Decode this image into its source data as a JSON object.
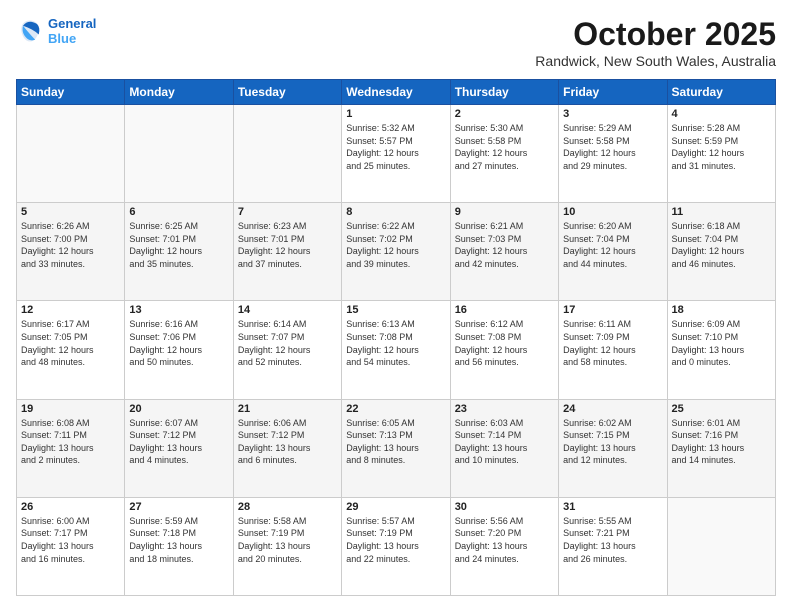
{
  "header": {
    "logo_line1": "General",
    "logo_line2": "Blue",
    "title": "October 2025",
    "location": "Randwick, New South Wales, Australia"
  },
  "days_of_week": [
    "Sunday",
    "Monday",
    "Tuesday",
    "Wednesday",
    "Thursday",
    "Friday",
    "Saturday"
  ],
  "weeks": [
    [
      {
        "day": "",
        "info": ""
      },
      {
        "day": "",
        "info": ""
      },
      {
        "day": "",
        "info": ""
      },
      {
        "day": "1",
        "info": "Sunrise: 5:32 AM\nSunset: 5:57 PM\nDaylight: 12 hours\nand 25 minutes."
      },
      {
        "day": "2",
        "info": "Sunrise: 5:30 AM\nSunset: 5:58 PM\nDaylight: 12 hours\nand 27 minutes."
      },
      {
        "day": "3",
        "info": "Sunrise: 5:29 AM\nSunset: 5:58 PM\nDaylight: 12 hours\nand 29 minutes."
      },
      {
        "day": "4",
        "info": "Sunrise: 5:28 AM\nSunset: 5:59 PM\nDaylight: 12 hours\nand 31 minutes."
      }
    ],
    [
      {
        "day": "5",
        "info": "Sunrise: 6:26 AM\nSunset: 7:00 PM\nDaylight: 12 hours\nand 33 minutes."
      },
      {
        "day": "6",
        "info": "Sunrise: 6:25 AM\nSunset: 7:01 PM\nDaylight: 12 hours\nand 35 minutes."
      },
      {
        "day": "7",
        "info": "Sunrise: 6:23 AM\nSunset: 7:01 PM\nDaylight: 12 hours\nand 37 minutes."
      },
      {
        "day": "8",
        "info": "Sunrise: 6:22 AM\nSunset: 7:02 PM\nDaylight: 12 hours\nand 39 minutes."
      },
      {
        "day": "9",
        "info": "Sunrise: 6:21 AM\nSunset: 7:03 PM\nDaylight: 12 hours\nand 42 minutes."
      },
      {
        "day": "10",
        "info": "Sunrise: 6:20 AM\nSunset: 7:04 PM\nDaylight: 12 hours\nand 44 minutes."
      },
      {
        "day": "11",
        "info": "Sunrise: 6:18 AM\nSunset: 7:04 PM\nDaylight: 12 hours\nand 46 minutes."
      }
    ],
    [
      {
        "day": "12",
        "info": "Sunrise: 6:17 AM\nSunset: 7:05 PM\nDaylight: 12 hours\nand 48 minutes."
      },
      {
        "day": "13",
        "info": "Sunrise: 6:16 AM\nSunset: 7:06 PM\nDaylight: 12 hours\nand 50 minutes."
      },
      {
        "day": "14",
        "info": "Sunrise: 6:14 AM\nSunset: 7:07 PM\nDaylight: 12 hours\nand 52 minutes."
      },
      {
        "day": "15",
        "info": "Sunrise: 6:13 AM\nSunset: 7:08 PM\nDaylight: 12 hours\nand 54 minutes."
      },
      {
        "day": "16",
        "info": "Sunrise: 6:12 AM\nSunset: 7:08 PM\nDaylight: 12 hours\nand 56 minutes."
      },
      {
        "day": "17",
        "info": "Sunrise: 6:11 AM\nSunset: 7:09 PM\nDaylight: 12 hours\nand 58 minutes."
      },
      {
        "day": "18",
        "info": "Sunrise: 6:09 AM\nSunset: 7:10 PM\nDaylight: 13 hours\nand 0 minutes."
      }
    ],
    [
      {
        "day": "19",
        "info": "Sunrise: 6:08 AM\nSunset: 7:11 PM\nDaylight: 13 hours\nand 2 minutes."
      },
      {
        "day": "20",
        "info": "Sunrise: 6:07 AM\nSunset: 7:12 PM\nDaylight: 13 hours\nand 4 minutes."
      },
      {
        "day": "21",
        "info": "Sunrise: 6:06 AM\nSunset: 7:12 PM\nDaylight: 13 hours\nand 6 minutes."
      },
      {
        "day": "22",
        "info": "Sunrise: 6:05 AM\nSunset: 7:13 PM\nDaylight: 13 hours\nand 8 minutes."
      },
      {
        "day": "23",
        "info": "Sunrise: 6:03 AM\nSunset: 7:14 PM\nDaylight: 13 hours\nand 10 minutes."
      },
      {
        "day": "24",
        "info": "Sunrise: 6:02 AM\nSunset: 7:15 PM\nDaylight: 13 hours\nand 12 minutes."
      },
      {
        "day": "25",
        "info": "Sunrise: 6:01 AM\nSunset: 7:16 PM\nDaylight: 13 hours\nand 14 minutes."
      }
    ],
    [
      {
        "day": "26",
        "info": "Sunrise: 6:00 AM\nSunset: 7:17 PM\nDaylight: 13 hours\nand 16 minutes."
      },
      {
        "day": "27",
        "info": "Sunrise: 5:59 AM\nSunset: 7:18 PM\nDaylight: 13 hours\nand 18 minutes."
      },
      {
        "day": "28",
        "info": "Sunrise: 5:58 AM\nSunset: 7:19 PM\nDaylight: 13 hours\nand 20 minutes."
      },
      {
        "day": "29",
        "info": "Sunrise: 5:57 AM\nSunset: 7:19 PM\nDaylight: 13 hours\nand 22 minutes."
      },
      {
        "day": "30",
        "info": "Sunrise: 5:56 AM\nSunset: 7:20 PM\nDaylight: 13 hours\nand 24 minutes."
      },
      {
        "day": "31",
        "info": "Sunrise: 5:55 AM\nSunset: 7:21 PM\nDaylight: 13 hours\nand 26 minutes."
      },
      {
        "day": "",
        "info": ""
      }
    ]
  ]
}
